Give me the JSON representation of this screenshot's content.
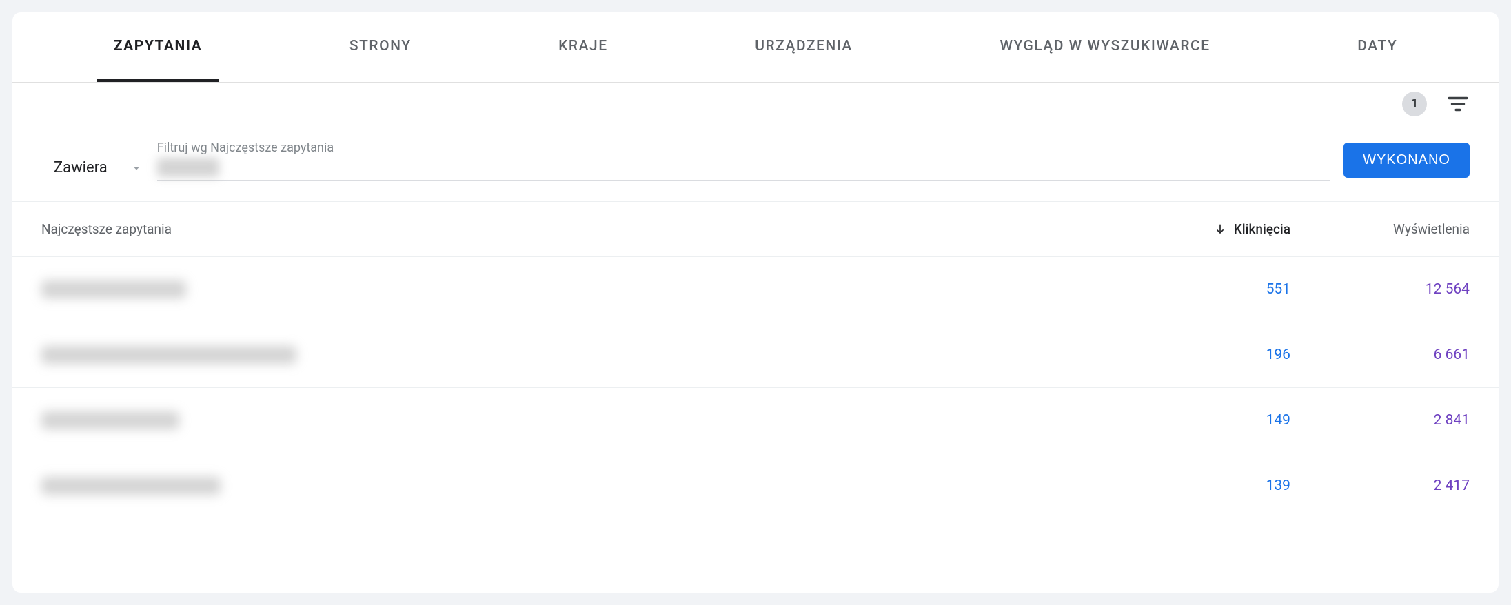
{
  "tabs": {
    "queries": "ZAPYTANIA",
    "pages": "STRONY",
    "countries": "KRAJE",
    "devices": "URZĄDZENIA",
    "appearance": "WYGLĄD W WYSZUKIWARCE",
    "dates": "DATY"
  },
  "toolbar": {
    "filter_count": "1"
  },
  "filter": {
    "mode_label": "Zawiera",
    "input_label": "Filtruj wg Najczęstsze zapytania",
    "input_value": "",
    "done_label": "WYKONANO"
  },
  "columns": {
    "query": "Najczęstsze zapytania",
    "clicks": "Kliknięcia",
    "impressions": "Wyświetlenia"
  },
  "rows": [
    {
      "query": "",
      "clicks": "551",
      "impressions": "12 564",
      "blur_w": 210
    },
    {
      "query": "",
      "clicks": "196",
      "impressions": "6 661",
      "blur_w": 370
    },
    {
      "query": "",
      "clicks": "149",
      "impressions": "2 841",
      "blur_w": 200
    },
    {
      "query": "",
      "clicks": "139",
      "impressions": "2 417",
      "blur_w": 260
    }
  ]
}
